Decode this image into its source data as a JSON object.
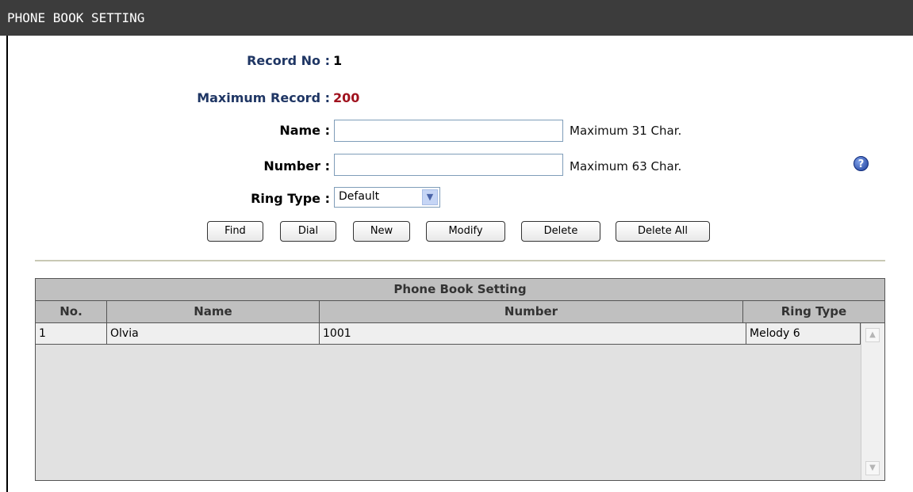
{
  "header": {
    "title": "PHONE BOOK SETTING"
  },
  "form": {
    "record_no_label": "Record No :",
    "record_no_value": "1",
    "max_record_label": "Maximum Record :",
    "max_record_value": "200",
    "name_label": "Name :",
    "name_value": "",
    "name_hint": "Maximum 31 Char.",
    "number_label": "Number :",
    "number_value": "",
    "number_hint": "Maximum 63 Char.",
    "ring_type_label": "Ring Type :",
    "ring_type_value": "Default"
  },
  "buttons": {
    "find": "Find",
    "dial": "Dial",
    "new": "New",
    "modify": "Modify",
    "delete": "Delete",
    "delete_all": "Delete All"
  },
  "table": {
    "caption": "Phone Book Setting",
    "columns": [
      "No.",
      "Name",
      "Number",
      "Ring Type"
    ],
    "rows": [
      {
        "no": "1",
        "name": "Olvia",
        "number": "1001",
        "ring_type": "Melody 6"
      }
    ]
  },
  "icons": {
    "help": "help-icon",
    "dropdown": "chevron-down-icon",
    "scroll_up": "scroll-up-arrow-icon",
    "scroll_down": "scroll-down-arrow-icon"
  },
  "colors": {
    "header_bg": "#3c3c3c",
    "label_blue": "#1f3664",
    "value_red": "#a0121e",
    "table_header_bg": "#c0c0c0"
  }
}
